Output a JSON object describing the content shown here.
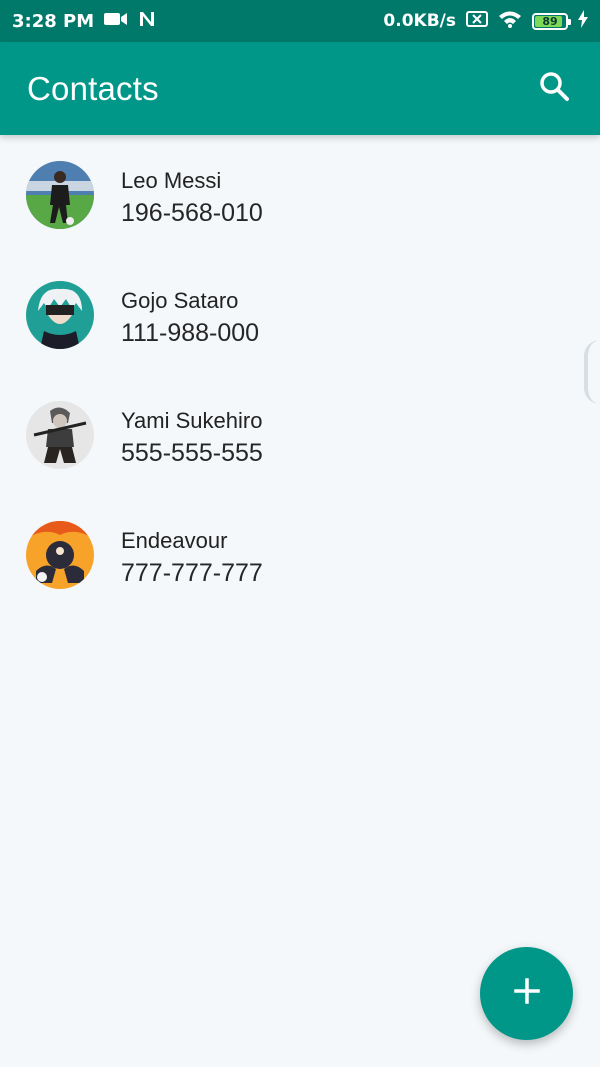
{
  "status_bar": {
    "time": "3:28 PM",
    "network_speed": "0.0KB/s",
    "battery_level": 89,
    "battery_label": "89",
    "icons": [
      "video-camera-icon",
      "n-notification-icon",
      "sim-off-icon",
      "wifi-icon",
      "battery-icon",
      "charging-icon"
    ]
  },
  "app_bar": {
    "title": "Contacts",
    "search_icon": "search-icon"
  },
  "colors": {
    "primary": "#009688",
    "status_bar": "#00796b",
    "background": "#f4f8fa"
  },
  "contacts": [
    {
      "name": "Leo Messi",
      "phone": "196-568-010",
      "avatar": "avatar-leo-messi"
    },
    {
      "name": "Gojo Sataro",
      "phone": "111-988-000",
      "avatar": "avatar-gojo-sataro"
    },
    {
      "name": "Yami Sukehiro",
      "phone": "555-555-555",
      "avatar": "avatar-yami-sukehiro"
    },
    {
      "name": "Endeavour",
      "phone": "777-777-777",
      "avatar": "avatar-endeavour"
    }
  ],
  "fab": {
    "icon": "plus-icon",
    "action": "add-contact"
  }
}
